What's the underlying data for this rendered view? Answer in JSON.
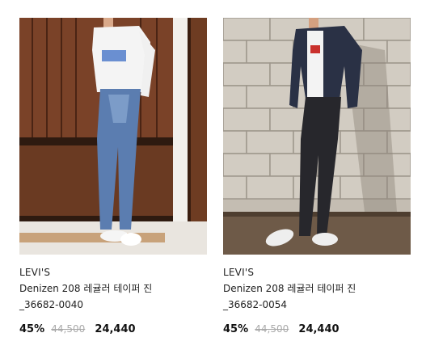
{
  "products": [
    {
      "brand": "LEVI'S",
      "name": "Denizen 208 레귤러 테이퍼 진",
      "code": "_36682-0040",
      "discount": "45%",
      "original_price": "44,500",
      "sale_price": "24,440"
    },
    {
      "brand": "LEVI'S",
      "name": "Denizen 208 레귤러 테이퍼 진",
      "code": "_36682-0054",
      "discount": "45%",
      "original_price": "44,500",
      "sale_price": "24,440"
    }
  ],
  "colors": {
    "text": "#222222",
    "original_price": "#aaaaaa",
    "wood_dark": "#4a2a1a",
    "wood_light": "#8a4f30",
    "brick": "#c9c3b8",
    "jacket": "#2a3145"
  }
}
